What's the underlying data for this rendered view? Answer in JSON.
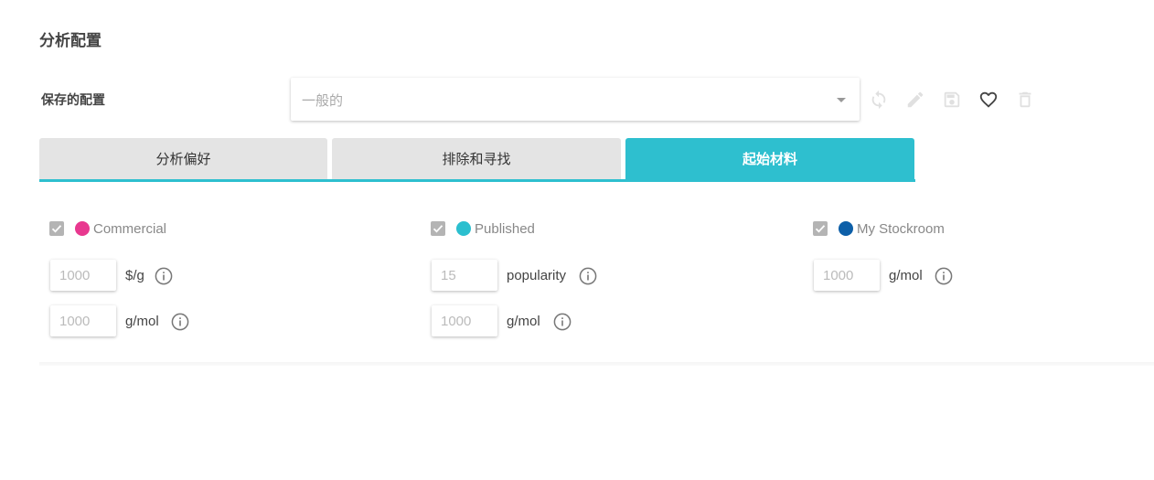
{
  "page_title": "分析配置",
  "saved_config": {
    "label": "保存的配置",
    "placeholder": "一般的"
  },
  "toolbar_icons": [
    "refresh-icon",
    "edit-icon",
    "save-icon",
    "heart-icon",
    "delete-icon"
  ],
  "tabs": [
    {
      "label": "分析偏好",
      "active": false
    },
    {
      "label": "排除和寻找",
      "active": false
    },
    {
      "label": "起始材料",
      "active": true
    }
  ],
  "sources": [
    {
      "name": "Commercial",
      "color": "#e8388f",
      "checked": true,
      "fields": [
        {
          "placeholder": "1000",
          "unit": "$/g"
        },
        {
          "placeholder": "1000",
          "unit": "g/mol"
        }
      ]
    },
    {
      "name": "Published",
      "color": "#2bbfcf",
      "checked": true,
      "fields": [
        {
          "placeholder": "15",
          "unit": "popularity"
        },
        {
          "placeholder": "1000",
          "unit": "g/mol"
        }
      ]
    },
    {
      "name": "My Stockroom",
      "color": "#0d5fa8",
      "checked": true,
      "fields": [
        {
          "placeholder": "1000",
          "unit": "g/mol"
        }
      ]
    }
  ],
  "colors": {
    "accent": "#2ebfcf",
    "tab_inactive": "#e4e4e4"
  }
}
